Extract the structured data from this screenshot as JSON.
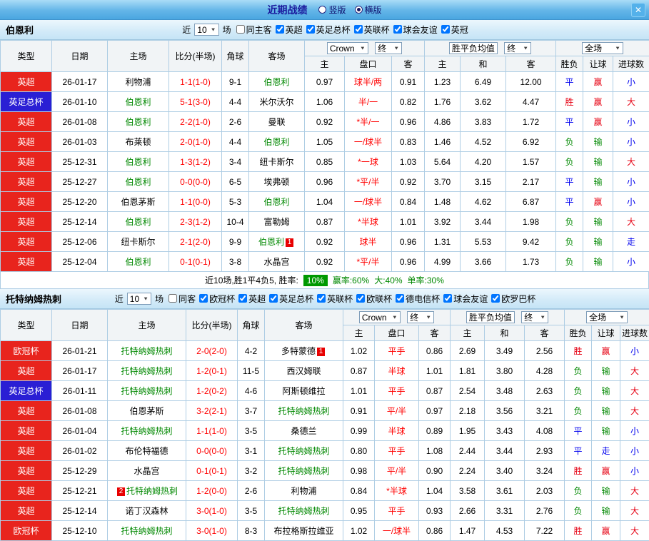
{
  "header": {
    "title": "近期战绩",
    "vertical": "竖版",
    "horizontal": "横版",
    "close": "✕"
  },
  "filter_labels": {
    "near": "近",
    "games": "场"
  },
  "controls": {
    "bookmaker": "Crown",
    "final": "终",
    "avg": "胜平负均值",
    "full": "全场"
  },
  "cols": {
    "type": "类型",
    "date": "日期",
    "home": "主场",
    "score": "比分(半场)",
    "corner": "角球",
    "away": "客场",
    "h": "主",
    "handicap": "盘口",
    "a": "客",
    "draw": "和",
    "wdl": "胜负",
    "hcp": "让球",
    "goals": "进球数"
  },
  "colors": {
    "league_red": "#e8241d",
    "league_blue": "#2a1fd4",
    "res_win": "#e60012",
    "res_draw": "#0000ee",
    "res_lose": "#008800",
    "score": "#ff0000",
    "focus_team": "#008800",
    "rate_badge": "#009900",
    "topbar_title": "#1b1b9e"
  },
  "sections": [
    {
      "team": "伯恩利",
      "filter": {
        "count": "10",
        "checks": [
          {
            "label": "同主客",
            "checked": false
          },
          {
            "label": "英超",
            "checked": true
          },
          {
            "label": "英足总杯",
            "checked": true
          },
          {
            "label": "英联杯",
            "checked": true
          },
          {
            "label": "球会友谊",
            "checked": true
          },
          {
            "label": "英冠",
            "checked": true
          }
        ]
      },
      "rows": [
        {
          "league": "英超",
          "lcolor": "red",
          "date": "26-01-17",
          "home": "利物浦",
          "score": "1-1(1-0)",
          "corners": "9-1",
          "away": "伯恩利",
          "awayFocus": true,
          "odds": [
            "0.97",
            "球半/两",
            "0.91"
          ],
          "avg": [
            "1.23",
            "6.49",
            "12.00"
          ],
          "res": [
            "平",
            "赢",
            "小"
          ]
        },
        {
          "league": "英足总杯",
          "lcolor": "blue",
          "date": "26-01-10",
          "home": "伯恩利",
          "homeFocus": true,
          "score": "5-1(3-0)",
          "corners": "4-4",
          "away": "米尔沃尔",
          "odds": [
            "1.06",
            "半/一",
            "0.82"
          ],
          "avg": [
            "1.76",
            "3.62",
            "4.47"
          ],
          "res": [
            "胜",
            "赢",
            "大"
          ]
        },
        {
          "league": "英超",
          "lcolor": "red",
          "date": "26-01-08",
          "home": "伯恩利",
          "homeFocus": true,
          "score": "2-2(1-0)",
          "corners": "2-6",
          "away": "曼联",
          "odds": [
            "0.92",
            "*半/一",
            "0.96"
          ],
          "avg": [
            "4.86",
            "3.83",
            "1.72"
          ],
          "res": [
            "平",
            "赢",
            "小"
          ]
        },
        {
          "league": "英超",
          "lcolor": "red",
          "date": "26-01-03",
          "home": "布莱顿",
          "score": "2-0(1-0)",
          "corners": "4-4",
          "away": "伯恩利",
          "awayFocus": true,
          "odds": [
            "1.05",
            "一/球半",
            "0.83"
          ],
          "avg": [
            "1.46",
            "4.52",
            "6.92"
          ],
          "res": [
            "负",
            "输",
            "小"
          ]
        },
        {
          "league": "英超",
          "lcolor": "red",
          "date": "25-12-31",
          "home": "伯恩利",
          "homeFocus": true,
          "score": "1-3(1-2)",
          "corners": "3-4",
          "away": "纽卡斯尔",
          "odds": [
            "0.85",
            "*一球",
            "1.03"
          ],
          "avg": [
            "5.64",
            "4.20",
            "1.57"
          ],
          "res": [
            "负",
            "输",
            "大"
          ]
        },
        {
          "league": "英超",
          "lcolor": "red",
          "date": "25-12-27",
          "home": "伯恩利",
          "homeFocus": true,
          "score": "0-0(0-0)",
          "corners": "6-5",
          "away": "埃弗顿",
          "odds": [
            "0.96",
            "*平/半",
            "0.92"
          ],
          "avg": [
            "3.70",
            "3.15",
            "2.17"
          ],
          "res": [
            "平",
            "输",
            "小"
          ]
        },
        {
          "league": "英超",
          "lcolor": "red",
          "date": "25-12-20",
          "home": "伯恩茅斯",
          "score": "1-1(0-0)",
          "corners": "5-3",
          "away": "伯恩利",
          "awayFocus": true,
          "odds": [
            "1.04",
            "一/球半",
            "0.84"
          ],
          "avg": [
            "1.48",
            "4.62",
            "6.87"
          ],
          "res": [
            "平",
            "赢",
            "小"
          ]
        },
        {
          "league": "英超",
          "lcolor": "red",
          "date": "25-12-14",
          "home": "伯恩利",
          "homeFocus": true,
          "score": "2-3(1-2)",
          "corners": "10-4",
          "away": "富勒姆",
          "odds": [
            "0.87",
            "*半球",
            "1.01"
          ],
          "avg": [
            "3.92",
            "3.44",
            "1.98"
          ],
          "res": [
            "负",
            "输",
            "大"
          ]
        },
        {
          "league": "英超",
          "lcolor": "red",
          "date": "25-12-06",
          "home": "纽卡斯尔",
          "score": "2-1(2-0)",
          "corners": "9-9",
          "away": "伯恩利",
          "awayFocus": true,
          "awayBadge": "1",
          "odds": [
            "0.92",
            "球半",
            "0.96"
          ],
          "avg": [
            "1.31",
            "5.53",
            "9.42"
          ],
          "res": [
            "负",
            "输",
            "走"
          ]
        },
        {
          "league": "英超",
          "lcolor": "red",
          "date": "25-12-04",
          "home": "伯恩利",
          "homeFocus": true,
          "score": "0-1(0-1)",
          "corners": "3-8",
          "away": "水晶宫",
          "odds": [
            "0.92",
            "*平/半",
            "0.96"
          ],
          "avg": [
            "4.99",
            "3.66",
            "1.73"
          ],
          "res": [
            "负",
            "输",
            "小"
          ]
        }
      ],
      "summary": {
        "prefix": "近10场,胜1平4负5, 胜率:",
        "rate_badge": "10%",
        "win_rate": "赢率:60%",
        "big_rate": "大:40%",
        "single_rate": "单率:30%"
      }
    },
    {
      "team": "托特纳姆热刺",
      "filter": {
        "count": "10",
        "checks": [
          {
            "label": "同客",
            "checked": false
          },
          {
            "label": "欧冠杯",
            "checked": true
          },
          {
            "label": "英超",
            "checked": true
          },
          {
            "label": "英足总杯",
            "checked": true
          },
          {
            "label": "英联杯",
            "checked": true
          },
          {
            "label": "欧联杯",
            "checked": true
          },
          {
            "label": "德电信杯",
            "checked": true
          },
          {
            "label": "球会友谊",
            "checked": true
          },
          {
            "label": "欧罗巴杯",
            "checked": true
          }
        ]
      },
      "rows": [
        {
          "league": "欧冠杯",
          "lcolor": "red",
          "date": "26-01-21",
          "home": "托特纳姆热刺",
          "homeFocus": true,
          "score": "2-0(2-0)",
          "corners": "4-2",
          "away": "多特蒙德",
          "awayBadge": "1",
          "odds": [
            "1.02",
            "平手",
            "0.86"
          ],
          "avg": [
            "2.69",
            "3.49",
            "2.56"
          ],
          "res": [
            "胜",
            "赢",
            "小"
          ]
        },
        {
          "league": "英超",
          "lcolor": "red",
          "date": "26-01-17",
          "home": "托特纳姆热刺",
          "homeFocus": true,
          "score": "1-2(0-1)",
          "corners": "11-5",
          "away": "西汉姆联",
          "odds": [
            "0.87",
            "半球",
            "1.01"
          ],
          "avg": [
            "1.81",
            "3.80",
            "4.28"
          ],
          "res": [
            "负",
            "输",
            "大"
          ]
        },
        {
          "league": "英足总杯",
          "lcolor": "blue",
          "date": "26-01-11",
          "home": "托特纳姆热刺",
          "homeFocus": true,
          "score": "1-2(0-2)",
          "corners": "4-6",
          "away": "阿斯顿维拉",
          "odds": [
            "1.01",
            "平手",
            "0.87"
          ],
          "avg": [
            "2.54",
            "3.48",
            "2.63"
          ],
          "res": [
            "负",
            "输",
            "大"
          ]
        },
        {
          "league": "英超",
          "lcolor": "red",
          "date": "26-01-08",
          "home": "伯恩茅斯",
          "score": "3-2(2-1)",
          "corners": "3-7",
          "away": "托特纳姆热刺",
          "awayFocus": true,
          "odds": [
            "0.91",
            "平/半",
            "0.97"
          ],
          "avg": [
            "2.18",
            "3.56",
            "3.21"
          ],
          "res": [
            "负",
            "输",
            "大"
          ]
        },
        {
          "league": "英超",
          "lcolor": "red",
          "date": "26-01-04",
          "home": "托特纳姆热刺",
          "homeFocus": true,
          "score": "1-1(1-0)",
          "corners": "3-5",
          "away": "桑德兰",
          "odds": [
            "0.99",
            "半球",
            "0.89"
          ],
          "avg": [
            "1.95",
            "3.43",
            "4.08"
          ],
          "res": [
            "平",
            "输",
            "小"
          ]
        },
        {
          "league": "英超",
          "lcolor": "red",
          "date": "26-01-02",
          "home": "布伦特福德",
          "score": "0-0(0-0)",
          "corners": "3-1",
          "away": "托特纳姆热刺",
          "awayFocus": true,
          "odds": [
            "0.80",
            "平手",
            "1.08"
          ],
          "avg": [
            "2.44",
            "3.44",
            "2.93"
          ],
          "res": [
            "平",
            "走",
            "小"
          ]
        },
        {
          "league": "英超",
          "lcolor": "red",
          "date": "25-12-29",
          "home": "水晶宫",
          "score": "0-1(0-1)",
          "corners": "3-2",
          "away": "托特纳姆热刺",
          "awayFocus": true,
          "odds": [
            "0.98",
            "平/半",
            "0.90"
          ],
          "avg": [
            "2.24",
            "3.40",
            "3.24"
          ],
          "res": [
            "胜",
            "赢",
            "小"
          ]
        },
        {
          "league": "英超",
          "lcolor": "red",
          "date": "25-12-21",
          "home": "托特纳姆热刺",
          "homeFocus": true,
          "homeBadgePre": "2",
          "score": "1-2(0-0)",
          "corners": "2-6",
          "away": "利物浦",
          "odds": [
            "0.84",
            "*半球",
            "1.04"
          ],
          "avg": [
            "3.58",
            "3.61",
            "2.03"
          ],
          "res": [
            "负",
            "输",
            "大"
          ]
        },
        {
          "league": "英超",
          "lcolor": "red",
          "date": "25-12-14",
          "home": "诺丁汉森林",
          "score": "3-0(1-0)",
          "corners": "3-5",
          "away": "托特纳姆热刺",
          "awayFocus": true,
          "odds": [
            "0.95",
            "平手",
            "0.93"
          ],
          "avg": [
            "2.66",
            "3.31",
            "2.76"
          ],
          "res": [
            "负",
            "输",
            "大"
          ]
        },
        {
          "league": "欧冠杯",
          "lcolor": "red",
          "date": "25-12-10",
          "home": "托特纳姆热刺",
          "homeFocus": true,
          "score": "3-0(1-0)",
          "corners": "8-3",
          "away": "布拉格斯拉维亚",
          "odds": [
            "1.02",
            "一/球半",
            "0.86"
          ],
          "avg": [
            "1.47",
            "4.53",
            "7.22"
          ],
          "res": [
            "胜",
            "赢",
            "大"
          ]
        }
      ]
    }
  ]
}
